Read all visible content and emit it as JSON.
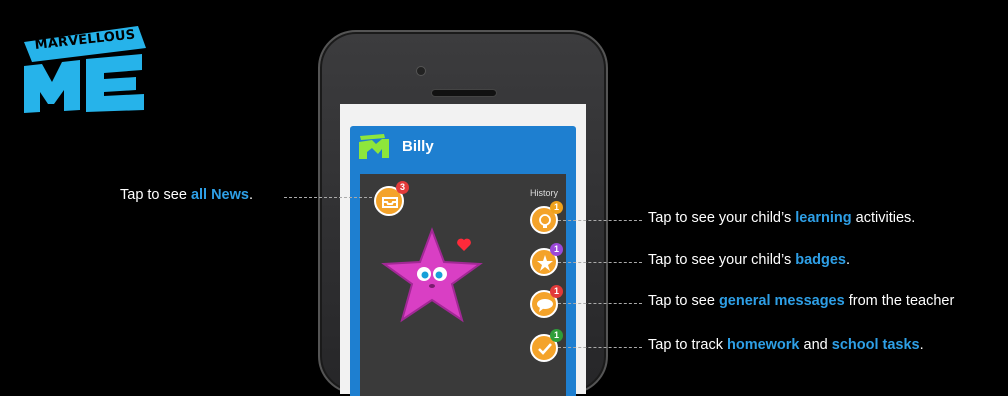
{
  "logo": {
    "word": "MARVELLOUS",
    "letters": "ME",
    "color": "#26b3ea"
  },
  "app": {
    "child_name": "Billy",
    "history_label": "History",
    "header_color": "#1e7fd0",
    "news_count": "3",
    "learning_count": "1",
    "badges_count": "1",
    "messages_count": "1",
    "homework_count": "1"
  },
  "callouts": {
    "news": {
      "pre": "Tap to see ",
      "hl": "all News",
      "post": "."
    },
    "learning": {
      "pre": "Tap to see your child’s ",
      "hl": "learning",
      "post": " activities."
    },
    "badges": {
      "pre": "Tap to see your child’s ",
      "hl": "badges",
      "post": "."
    },
    "messages": {
      "pre": "Tap to see ",
      "hl": "general messages",
      "post": " from the teacher"
    },
    "homework": {
      "pre": "Tap to track ",
      "hl": "homework",
      "mid": " and ",
      "hl2": "school tasks",
      "post": "."
    }
  },
  "icons": {
    "news": "inbox-icon",
    "learning": "globe-lightbulb-icon",
    "badges": "badge-star-icon",
    "messages": "hello-bubble-icon",
    "homework": "checkmark-icon",
    "mascot": "pink-star-mascot-icon",
    "heart": "heart-icon"
  }
}
